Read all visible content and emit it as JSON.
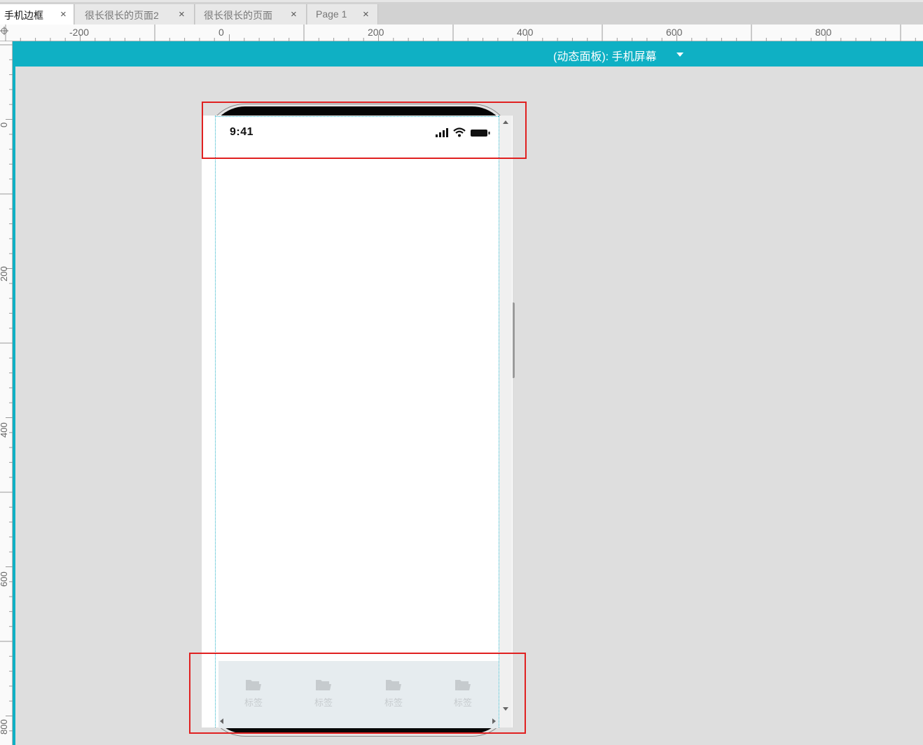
{
  "tabs": [
    {
      "label": "手机边框",
      "active": true
    },
    {
      "label": "很长很长的页面2",
      "active": false
    },
    {
      "label": "很长很长的页面",
      "active": false
    },
    {
      "label": "Page 1",
      "active": false
    }
  ],
  "tab_close_glyph": "×",
  "ruler": {
    "horizontal_labels": [
      "-200",
      "0",
      "200",
      "400",
      "600",
      "800"
    ],
    "vertical_labels": [
      "0",
      "200",
      "400",
      "600",
      "800"
    ]
  },
  "dynamic_panel": {
    "label": "(动态面板): 手机屏幕",
    "caret_icon": "caret-down-icon"
  },
  "phone": {
    "status_bar": {
      "time": "9:41",
      "icons": [
        "signal-icon",
        "wifi-icon",
        "battery-icon"
      ]
    },
    "tab_bar": {
      "items": [
        {
          "label": "标签",
          "icon": "folder-icon"
        },
        {
          "label": "标签",
          "icon": "folder-icon"
        },
        {
          "label": "标签",
          "icon": "folder-icon"
        },
        {
          "label": "标签",
          "icon": "folder-icon"
        }
      ]
    }
  },
  "colors": {
    "accent": "#0fb0c4",
    "highlight": "#e02020",
    "canvas": "#dedede",
    "tab_bar_bg": "#e6ecef"
  }
}
